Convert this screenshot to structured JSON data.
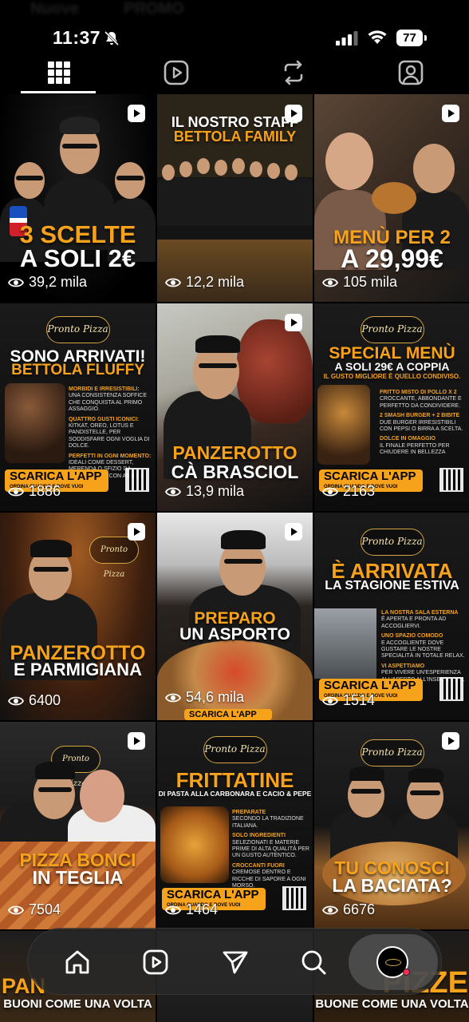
{
  "status_bar": {
    "time": "11:37",
    "battery": "77",
    "ghost_left": "Nuove",
    "ghost_mid": "PROMO"
  },
  "tabs": [
    {
      "name": "grid",
      "icon": "grid-icon",
      "active": true
    },
    {
      "name": "reels",
      "icon": "reels-icon",
      "active": false
    },
    {
      "name": "reposts",
      "icon": "repost-icon",
      "active": false
    },
    {
      "name": "tagged",
      "icon": "tagged-icon",
      "active": false
    }
  ],
  "posts": [
    {
      "line1": "3 SCELTE",
      "line2": "A SOLI 2€",
      "views": "39,2 mila",
      "reel": true
    },
    {
      "line1": "IL NOSTRO STAFF",
      "line2": "BETTOLA FAMILY",
      "views": "12,2 mila",
      "reel": true
    },
    {
      "line1": "MENÙ PER 2",
      "line2": "A 29,99€",
      "views": "105 mila",
      "reel": true,
      "logo": "Pronto Pizza"
    },
    {
      "line1": "SONO ARRIVATI!",
      "line2": "BETTOLA FLUFFY",
      "views": "1886",
      "reel": false,
      "logo": "Pronto Pizza",
      "sub": [
        [
          "MORBIDI E IRRESISTIBILI:",
          "UNA CONSISTENZA SOFFICE CHE CONQUISTA AL PRIMO ASSAGGIO."
        ],
        [
          "QUATTRO GUSTI ICONICI:",
          "KITKAT, OREO, LOTUS E PANDISTELLE, PER SODDISFARE OGNI VOGLIA DI DOLCE."
        ],
        [
          "PERFETTI IN OGNI MOMENTO:",
          "IDEALI COME DESSERT, MERENDA O SFIZIO DA CONDIVIDERE CON AMICI E FAMIGLIA."
        ]
      ],
      "app": "SCARICA L'APP",
      "app_sub": "ORDINA QUANDO E DOVE VUOI",
      "address": "VIA LATTANZIO 2, BARLETTA 0883513274 / 3897938943"
    },
    {
      "line1": "PANZEROTTO",
      "line2": "CÀ BRASCIOL",
      "views": "13,9 mila",
      "reel": true
    },
    {
      "line1": "SPECIAL MENÙ",
      "line2": "A SOLI 29€ A COPPIA",
      "line3": "IL GUSTO MIGLIORE È QUELLO CONDIVISO.",
      "views": "2163",
      "reel": false,
      "logo": "Pronto Pizza",
      "sub": [
        [
          "FRITTO MISTO DI POLLO X 2",
          "CROCCANTE, ABBONDANTE E PERFETTO DA CONDIVIDERE."
        ],
        [
          "2 SMASH BURGER + 2 BIBITE",
          "DUE BURGER IRRESISTIBILI CON PEPSI O BIRRA A SCELTA."
        ],
        [
          "DOLCE IN OMAGGIO",
          "IL FINALE PERFETTO PER CHIUDERE IN BELLEZZA"
        ]
      ],
      "app": "SCARICA L'APP",
      "app_sub": "ORDINA QUANDO E DOVE VUOI",
      "address": "VIA LATTANZIO 2, BARLETTA 0883513274 / 3897938943"
    },
    {
      "line1": "PANZEROTTO",
      "line2": "E PARMIGIANA",
      "views": "6400",
      "reel": true,
      "logo": "Pronto Pizza"
    },
    {
      "line1": "PREPARO",
      "line2": "UN ASPORTO",
      "views": "54,6 mila",
      "reel": true,
      "app": "SCARICA L'APP"
    },
    {
      "line1": "È ARRIVATA",
      "line2": "LA STAGIONE ESTIVA",
      "views": "1514",
      "reel": false,
      "logo": "Pronto Pizza",
      "sub": [
        [
          "LA NOSTRA SALA ESTERNA",
          "È APERTA E PRONTA AD ACCOGLIERVI."
        ],
        [
          "UNO SPAZIO COMODO",
          "E ACCOGLIENTE DOVE GUSTARE LE NOSTRE SPECIALITÀ IN TOTALE RELAX."
        ],
        [
          "VI ASPETTIAMO",
          "PER VIVERE UN'ESPERIENZA ALL'APERTO ALL'INSEGNA DEL BUON GUSTO."
        ]
      ],
      "app": "SCARICA L'APP",
      "app_sub": "ORDINA QUANDO E DOVE VUOI",
      "address": "VIA LATTANZIO 2, BARLETTA 0883513274 / 3897938943"
    },
    {
      "line1": "PIZZA BONCI",
      "line2": "IN TEGLIA",
      "views": "7504",
      "reel": true,
      "logo": "Pronto Pizza"
    },
    {
      "line1": "FRITTATINE",
      "line2": "DI PASTA ALLA CARBONARA E CACIO & PEPE",
      "views": "1464",
      "reel": false,
      "logo": "Pronto Pizza",
      "sub": [
        [
          "PREPARATE",
          "SECONDO LA TRADIZIONE ITALIANA."
        ],
        [
          "SOLO INGREDIENTI",
          "SELEZIONATI E MATERIE PRIME DI ALTA QUALITÀ PER UN GUSTO AUTENTICO."
        ],
        [
          "CROCCANTI FUORI",
          "CREMOSE DENTRO E RICCHE DI SAPORE A OGNI MORSO."
        ]
      ],
      "app": "SCARICA L'APP",
      "app_sub": "ORDINA QUANDO E DOVE VUOI",
      "address": "VIA LATTANZIO 2, BARLETTA 0883513274 / 3897938943"
    },
    {
      "line1": "TU CONOSCI",
      "line2": "LA BACIATA?",
      "views": "6676",
      "reel": true,
      "logo": "Pronto Pizza"
    },
    {
      "line1": "PAN",
      "line2": "BUONI COME UNA VOLTA"
    },
    {
      "line1": "",
      "line2": ""
    },
    {
      "line1": "PIZZE",
      "line2": "BUONE COME UNA VOLTA"
    }
  ],
  "bottom_nav": [
    {
      "name": "home",
      "icon": "home-icon"
    },
    {
      "name": "reels",
      "icon": "reels-icon"
    },
    {
      "name": "direct",
      "icon": "send-icon"
    },
    {
      "name": "search",
      "icon": "search-icon"
    },
    {
      "name": "profile",
      "icon": "profile-avatar",
      "active": true
    }
  ],
  "colors": {
    "accent_orange": "#f7a21b",
    "background": "#000000",
    "notification_dot": "#ff2d55"
  }
}
